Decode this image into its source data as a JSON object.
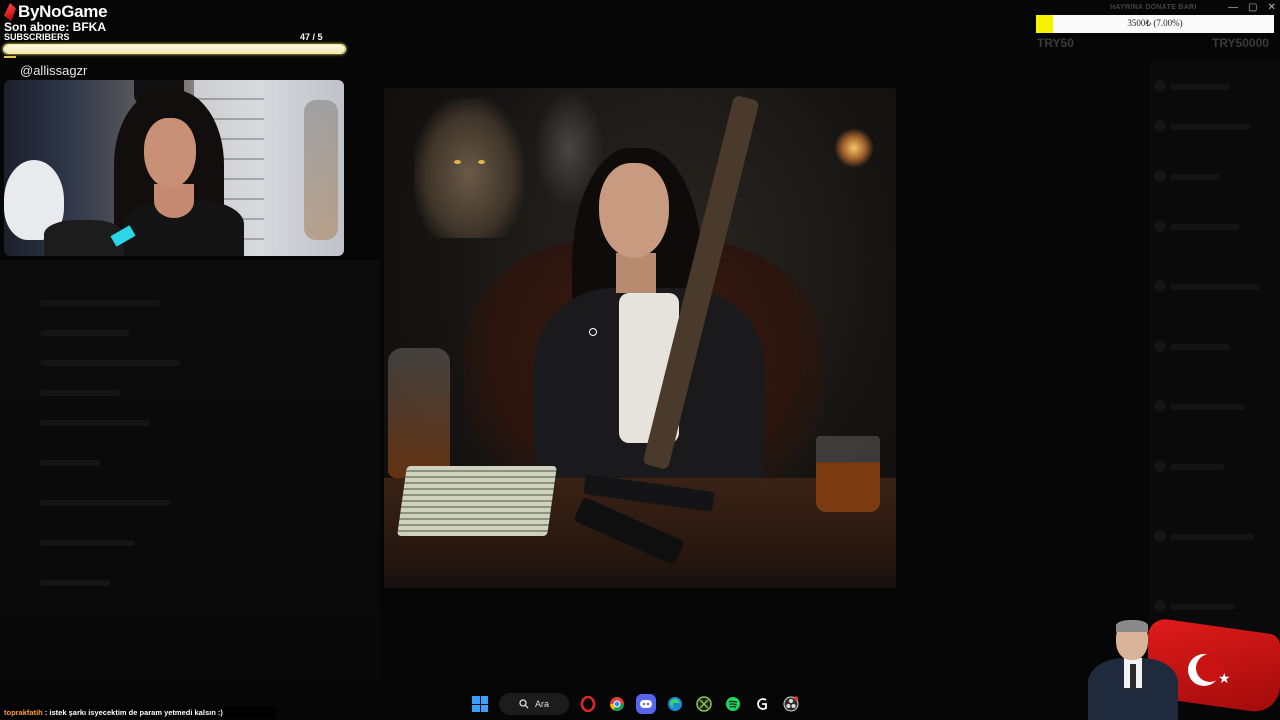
{
  "overlay": {
    "brand": "ByNoGame",
    "last_sub": "Son abone: BFKA",
    "sub_label": "SUBSCRIBERS",
    "sub_count": "47  / 5",
    "sub_progress": 1.0,
    "handle": "@allissagzr"
  },
  "donate": {
    "title": "HAYRINA DONATE BARI",
    "progress_text": "3500₺ (7.00%)",
    "progress": 0.07,
    "min_label": "TRY50",
    "max_label": "TRY50000",
    "fill_color": "#f7f200"
  },
  "window_controls": [
    "—",
    "▢",
    "✕"
  ],
  "chat": {
    "user": "toprakfatih",
    "message": " : istek şarkı isyecektim de param yetmedi kalsın :)"
  },
  "taskbar": {
    "search_label": "Ara",
    "icons": [
      "windows-start-icon",
      "search-icon",
      "opera-icon",
      "chrome-icon",
      "discord-icon",
      "edge-icon",
      "xbox-icon",
      "spotify-icon",
      "app-g-icon",
      "obs-icon"
    ]
  }
}
